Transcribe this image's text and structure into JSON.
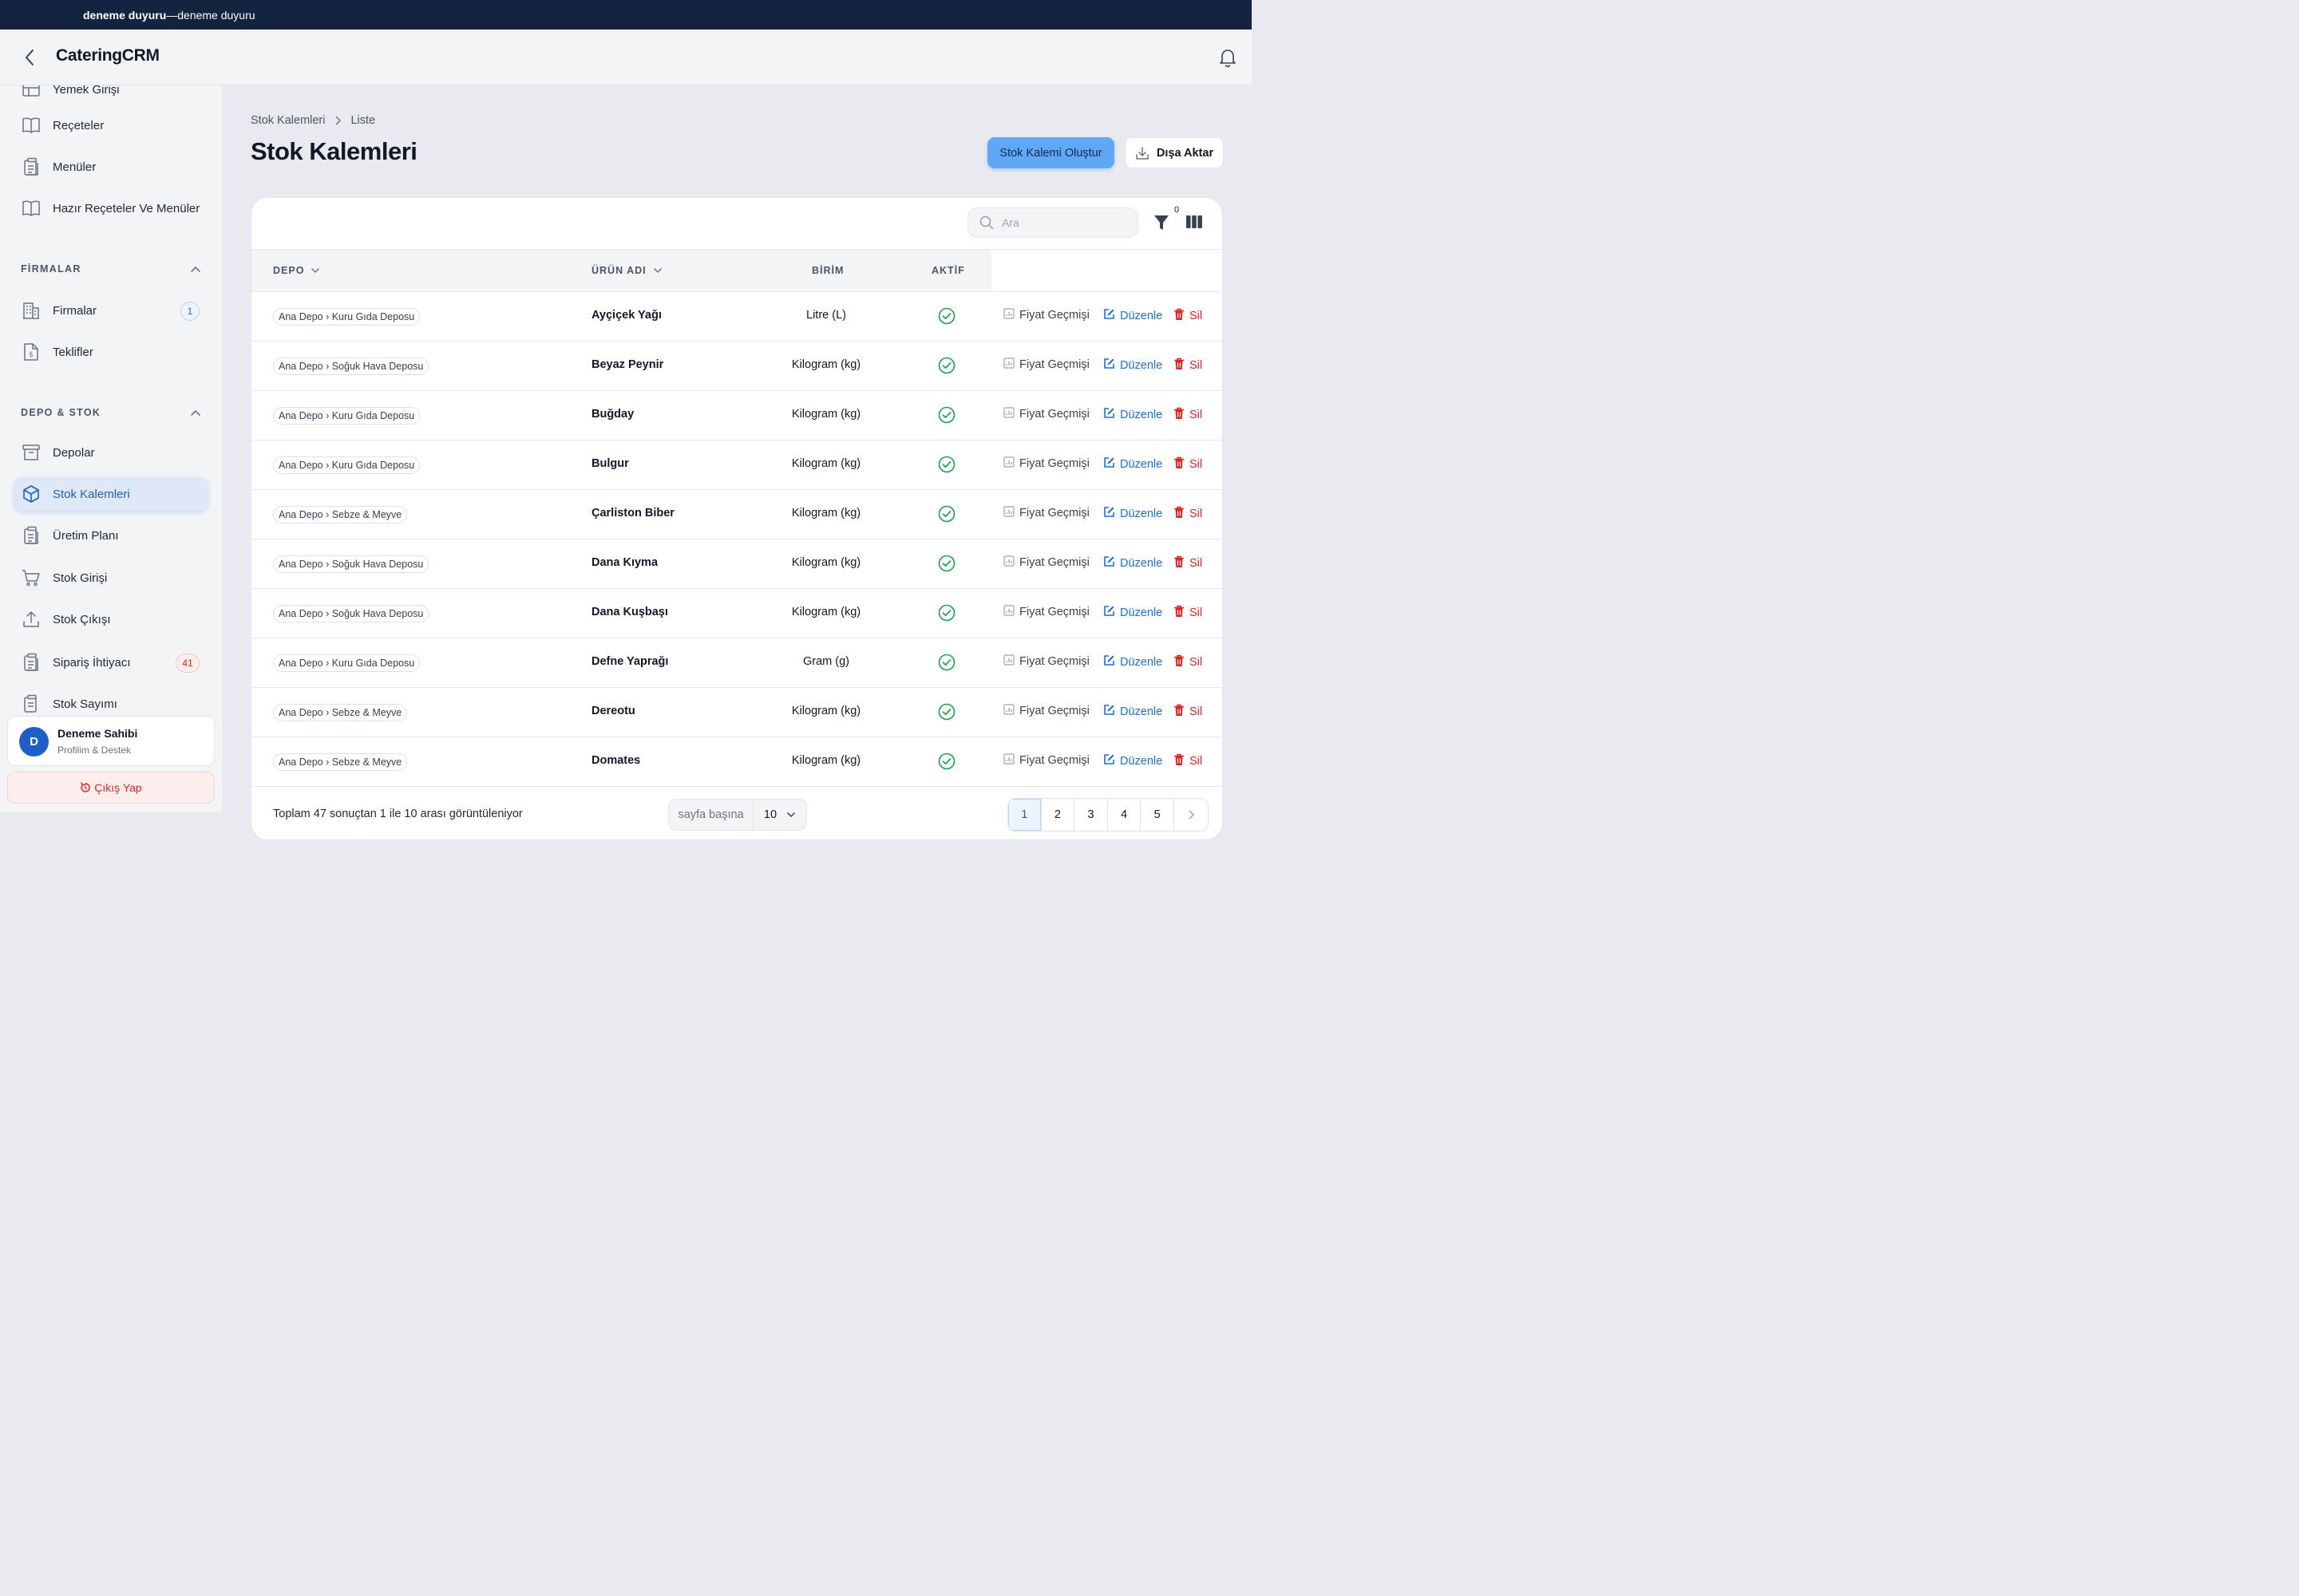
{
  "announcement": {
    "title": "deneme duyuru",
    "separator": " — ",
    "text": "deneme duyuru"
  },
  "app": {
    "title": "CateringCRM"
  },
  "sidebar": {
    "partial_item": "Yemek Girişi",
    "items_top": [
      {
        "label": "Reçeteler",
        "icon": "book-icon"
      },
      {
        "label": "Menüler",
        "icon": "clipboard-icon"
      },
      {
        "label": "Hazır Reçeteler Ve Menüler",
        "icon": "book-icon"
      }
    ],
    "sections": [
      {
        "title": "FİRMALAR",
        "items": [
          {
            "label": "Firmalar",
            "icon": "building-icon",
            "badge": "1"
          },
          {
            "label": "Teklifler",
            "icon": "document-dollar-icon"
          }
        ]
      },
      {
        "title": "DEPO & STOK",
        "items": [
          {
            "label": "Depolar",
            "icon": "archive-icon"
          },
          {
            "label": "Stok Kalemleri",
            "icon": "cube-icon",
            "active": true
          },
          {
            "label": "Üretim Planı",
            "icon": "clipboard-icon"
          },
          {
            "label": "Stok Girişi",
            "icon": "cart-icon"
          },
          {
            "label": "Stok Çıkışı",
            "icon": "upload-icon"
          },
          {
            "label": "Sipariş İhtiyacı",
            "icon": "clipboard-icon",
            "badge": "41"
          },
          {
            "label": "Stok Sayımı",
            "icon": "clipboard-icon"
          }
        ]
      }
    ],
    "profile": {
      "initial": "D",
      "name": "Deneme Sahibi",
      "subtitle": "Profilim & Destek"
    },
    "logout_label": "Çıkış Yap"
  },
  "breadcrumb": {
    "parent": "Stok Kalemleri",
    "current": "Liste"
  },
  "page": {
    "title": "Stok Kalemleri",
    "create_label": "Stok Kalemi Oluştur",
    "export_label": "Dışa Aktar"
  },
  "toolbar": {
    "search_placeholder": "Ara",
    "filter_count": "0"
  },
  "table": {
    "columns": {
      "depo": "DEPO",
      "name": "ÜRÜN ADI",
      "unit": "BİRİM",
      "active": "AKTİF"
    },
    "actions": {
      "price_history": "Fiyat Geçmişi",
      "edit": "Düzenle",
      "delete": "Sil"
    },
    "rows": [
      {
        "depo": "Ana Depo › Kuru Gıda Deposu",
        "name": "Ayçiçek Yağı",
        "unit": "Litre (L)",
        "active": true
      },
      {
        "depo": "Ana Depo › Soğuk Hava Deposu",
        "name": "Beyaz Peynir",
        "unit": "Kilogram (kg)",
        "active": true
      },
      {
        "depo": "Ana Depo › Kuru Gıda Deposu",
        "name": "Buğday",
        "unit": "Kilogram (kg)",
        "active": true
      },
      {
        "depo": "Ana Depo › Kuru Gıda Deposu",
        "name": "Bulgur",
        "unit": "Kilogram (kg)",
        "active": true
      },
      {
        "depo": "Ana Depo › Sebze & Meyve",
        "name": "Çarliston Biber",
        "unit": "Kilogram (kg)",
        "active": true
      },
      {
        "depo": "Ana Depo › Soğuk Hava Deposu",
        "name": "Dana Kıyma",
        "unit": "Kilogram (kg)",
        "active": true
      },
      {
        "depo": "Ana Depo › Soğuk Hava Deposu",
        "name": "Dana Kuşbaşı",
        "unit": "Kilogram (kg)",
        "active": true
      },
      {
        "depo": "Ana Depo › Kuru Gıda Deposu",
        "name": "Defne Yaprağı",
        "unit": "Gram (g)",
        "active": true
      },
      {
        "depo": "Ana Depo › Sebze & Meyve",
        "name": "Dereotu",
        "unit": "Kilogram (kg)",
        "active": true
      },
      {
        "depo": "Ana Depo › Sebze & Meyve",
        "name": "Domates",
        "unit": "Kilogram (kg)",
        "active": true
      }
    ]
  },
  "pagination": {
    "summary": "Toplam 47 sonuçtan 1 ile 10 arası görüntüleniyor",
    "per_page_label": "sayfa başına",
    "per_page_value": "10",
    "pages": [
      "1",
      "2",
      "3",
      "4",
      "5"
    ],
    "current_page": "1"
  },
  "colors": {
    "accent": "#1d5fc4",
    "primary_button": "#5fa8f5",
    "success": "#16a34a",
    "danger": "#dc2626",
    "topbar": "#14233f"
  }
}
